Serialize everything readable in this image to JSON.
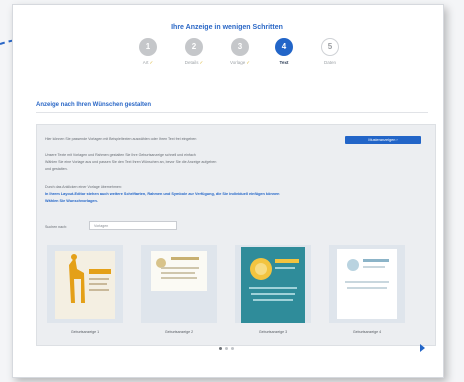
{
  "header": {
    "headline": "Ihre Anzeige in wenigen Schritten"
  },
  "steps": [
    {
      "number": "1",
      "label": "Art",
      "state": "done"
    },
    {
      "number": "2",
      "label": "Details",
      "state": "done"
    },
    {
      "number": "3",
      "label": "Vorlage",
      "state": "done"
    },
    {
      "number": "4",
      "label": "Text",
      "state": "active"
    },
    {
      "number": "5",
      "label": "Daten",
      "state": "todo"
    }
  ],
  "section": {
    "title": "Anzeige nach Ihren Wünschen gestalten"
  },
  "panel": {
    "intro": "Hier können Sie passende Vorlagen mit Beispieltexten auswählen oder Ihren Text frei eingeben",
    "button_label": "Musteranzeigen ›",
    "body_lines": [
      "Unsere Texte mit Vorlagen und Rahmen gestalten Sie Ihre Geburtsanzeige schnell und einfach",
      "Wählen Sie eine Vorlage aus und passen Sie den Text Ihren Wünschen an, bevor Sie die Anzeige aufgeben",
      "und gestalten."
    ],
    "hint": "Durch das Anklicken einer Vorlage übernehmen:",
    "highlight_lines": [
      "In Ihrem Layout-Editor stehen auch weitere Schriftarten, Rahmen und Symbole zur Verfügung, die Sie individuell einfügen können",
      "Wählen Sie Wunschvorlagen."
    ],
    "search_label": "Suchen nach:",
    "search_placeholder": "Vorlagen",
    "thumbnails": [
      {
        "label": "Geburtsanzeige 1",
        "colors": {
          "bg": "#f4efe2",
          "accent": "#e4a018"
        }
      },
      {
        "label": "Geburtsanzeige 2",
        "colors": {
          "bg": "#fbfaf4",
          "accent": "#c8b070"
        }
      },
      {
        "label": "Geburtsanzeige 3",
        "colors": {
          "bg": "#2f8c9a",
          "accent": "#f3c43f"
        }
      },
      {
        "label": "Geburtsanzeige 4",
        "colors": {
          "bg": "#ffffff",
          "accent": "#8cb4c8"
        }
      }
    ]
  },
  "colors": {
    "primary": "#2265c8",
    "check": "#d8b330"
  }
}
